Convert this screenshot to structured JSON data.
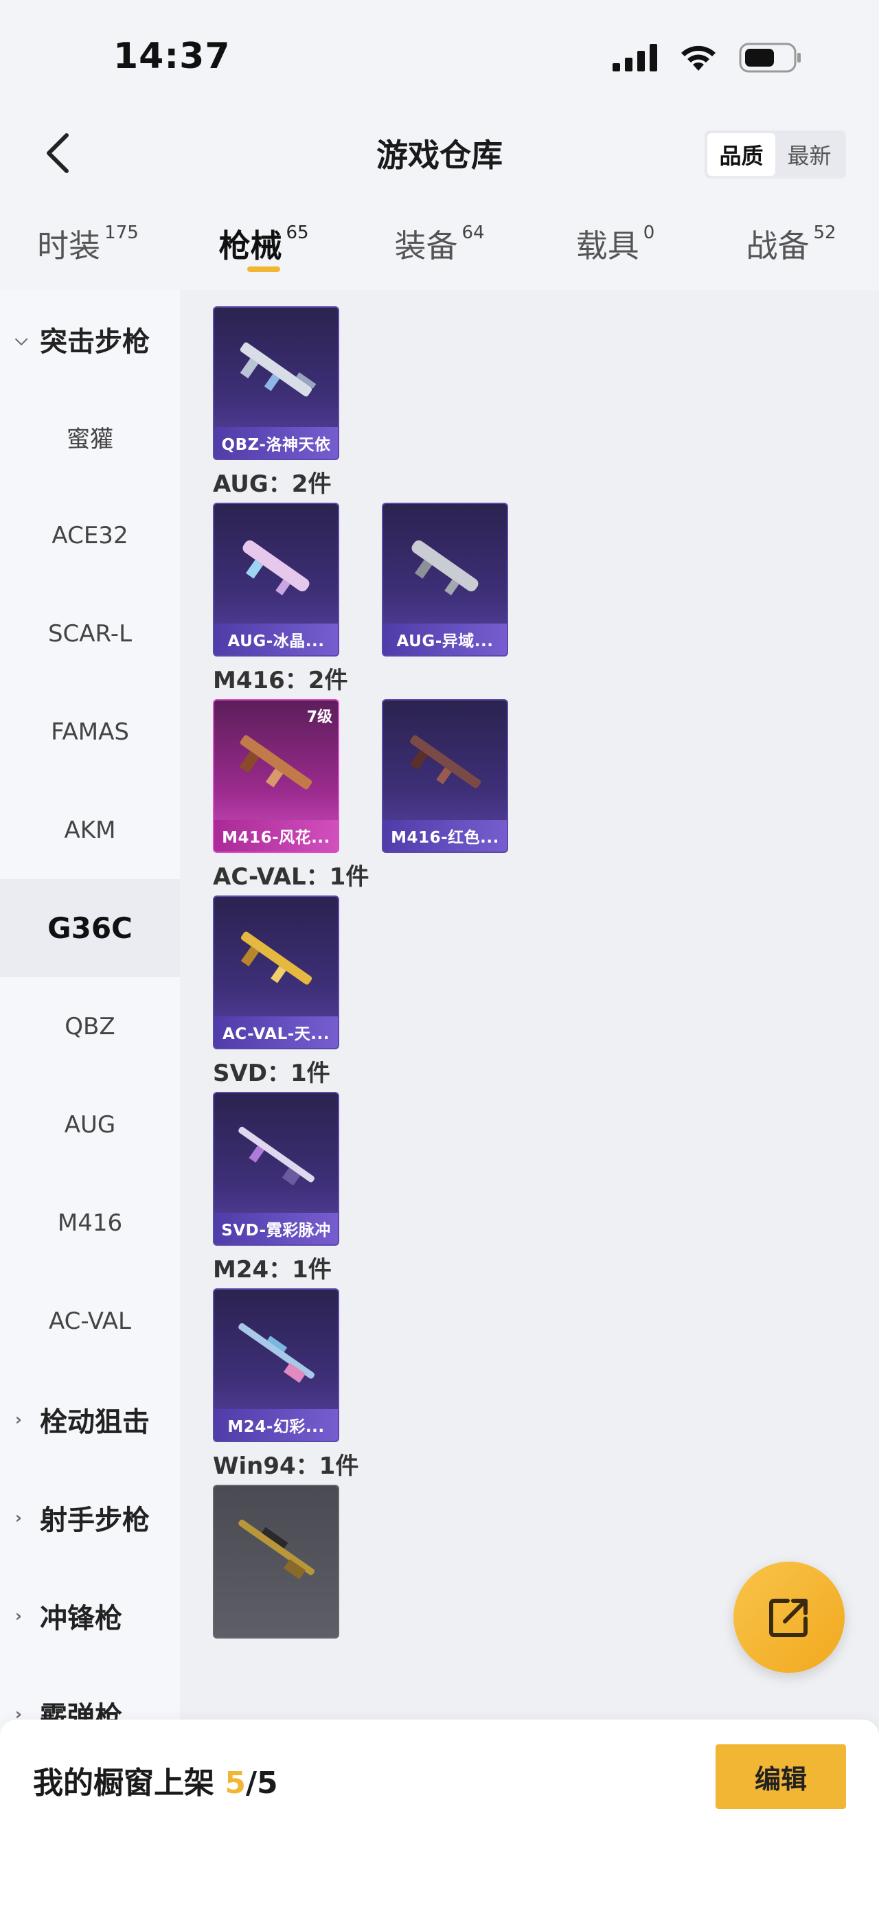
{
  "status_bar": {
    "time": "14:37"
  },
  "header": {
    "title": "游戏仓库",
    "sort_options": [
      "品质",
      "最新"
    ],
    "active_sort": "品质"
  },
  "tabs": [
    {
      "label": "时装",
      "count": "175"
    },
    {
      "label": "枪械",
      "count": "65",
      "active": true
    },
    {
      "label": "装备",
      "count": "64"
    },
    {
      "label": "载具",
      "count": "0"
    },
    {
      "label": "战备",
      "count": "52"
    }
  ],
  "sidebar": {
    "items": [
      {
        "label": "突击步枪",
        "type": "group",
        "expanded": true
      },
      {
        "label": "蜜獾"
      },
      {
        "label": "ACE32"
      },
      {
        "label": "SCAR-L"
      },
      {
        "label": "FAMAS"
      },
      {
        "label": "AKM"
      },
      {
        "label": "G36C",
        "selected": true
      },
      {
        "label": "QBZ"
      },
      {
        "label": "AUG"
      },
      {
        "label": "M416"
      },
      {
        "label": "AC-VAL"
      },
      {
        "label": "栓动狙击",
        "type": "group"
      },
      {
        "label": "射手步枪",
        "type": "group"
      },
      {
        "label": "冲锋枪",
        "type": "group"
      },
      {
        "label": "霰弹枪",
        "type": "group"
      }
    ]
  },
  "sections": [
    {
      "title": "",
      "cards": [
        {
          "name": "QBZ-洛神天依",
          "style": "purple"
        }
      ]
    },
    {
      "title": "AUG：2件",
      "cards": [
        {
          "name": "AUG-冰晶...",
          "style": "purple"
        },
        {
          "name": "AUG-异域...",
          "style": "purple"
        }
      ]
    },
    {
      "title": "M416：2件",
      "cards": [
        {
          "name": "M416-风花...",
          "style": "pink",
          "level": "7级"
        },
        {
          "name": "M416-红色...",
          "style": "purple"
        }
      ]
    },
    {
      "title": "AC-VAL：1件",
      "cards": [
        {
          "name": "AC-VAL-天...",
          "style": "purple"
        }
      ]
    },
    {
      "title": "SVD：1件",
      "cards": [
        {
          "name": "SVD-霓彩脉冲",
          "style": "purple"
        }
      ]
    },
    {
      "title": "M24：1件",
      "cards": [
        {
          "name": "M24-幻彩...",
          "style": "purple"
        }
      ]
    },
    {
      "title": "Win94：1件",
      "cards": [
        {
          "name": "",
          "style": "grey"
        }
      ]
    }
  ],
  "bottom_bar": {
    "label": "我的橱窗上架",
    "count": "5",
    "total": "/5",
    "edit_label": "编辑"
  },
  "colors": {
    "accent": "#f1b633",
    "card_purple": "#4a3a8e",
    "card_pink": "#c64ab6"
  }
}
